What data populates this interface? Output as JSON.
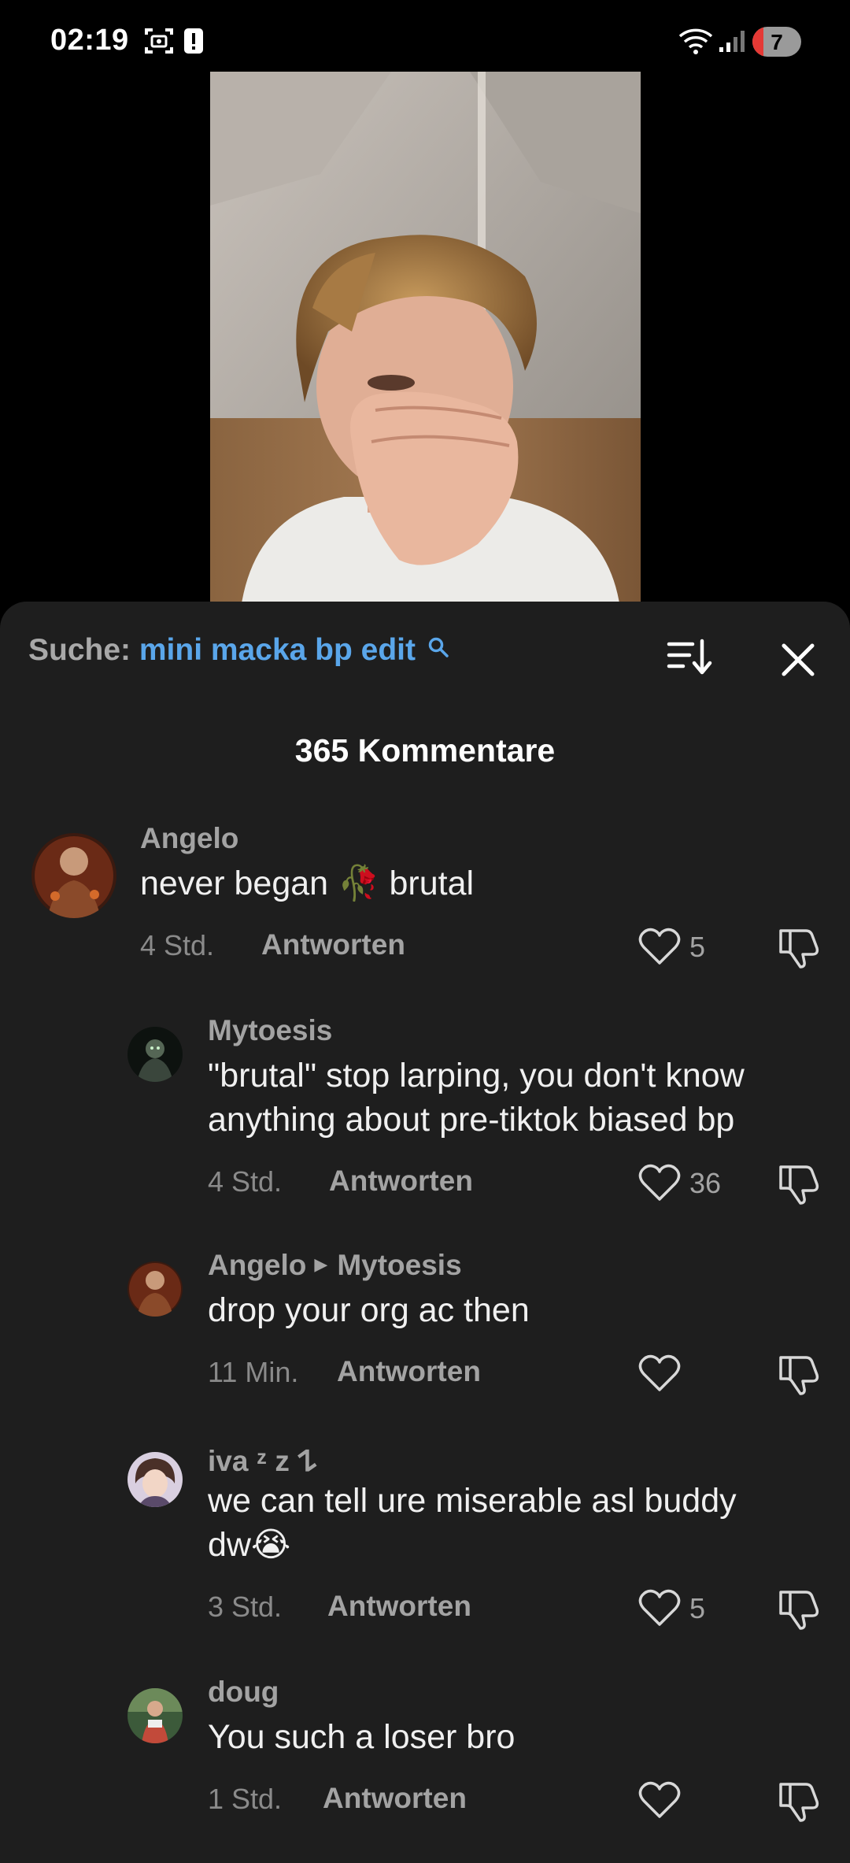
{
  "status_bar": {
    "time": "02:19",
    "battery_level": "7",
    "icons": [
      "screenshot-icon",
      "alert-icon",
      "wifi-icon",
      "signal-icon",
      "battery-icon"
    ]
  },
  "sheet": {
    "search_prefix": "Suche:",
    "search_query": "mini macka bp edit",
    "comment_count_title": "365 Kommentare"
  },
  "comments": [
    {
      "user": "Angelo",
      "text": "never began 🥀 brutal",
      "time": "4 Std.",
      "reply_label": "Antworten",
      "likes": "5"
    },
    {
      "user": "Mytoesis",
      "text_line1": "\"brutal\" stop larping, you don't know",
      "text_line2": "anything about pre-tiktok biased bp",
      "time": "4 Std.",
      "reply_label": "Antworten",
      "likes": "36"
    },
    {
      "user": "Angelo",
      "reply_to": "Mytoesis",
      "text": "drop your org ac then",
      "time": "11 Min.",
      "reply_label": "Antworten",
      "likes": ""
    },
    {
      "user": "iva ᶻ z 𐰁",
      "text_line1": "we can tell ure miserable asl buddy",
      "text_line2": "dw😭",
      "time": "3 Std.",
      "reply_label": "Antworten",
      "likes": "5"
    },
    {
      "user": "doug",
      "text": "You such a loser bro",
      "time": "1 Std.",
      "reply_label": "Antworten",
      "likes": ""
    }
  ],
  "colors": {
    "sheet_bg": "#1e1e1e",
    "accent_link": "#5aa6ea",
    "muted_text": "#a3a3a3",
    "battery_low": "#e53935"
  }
}
